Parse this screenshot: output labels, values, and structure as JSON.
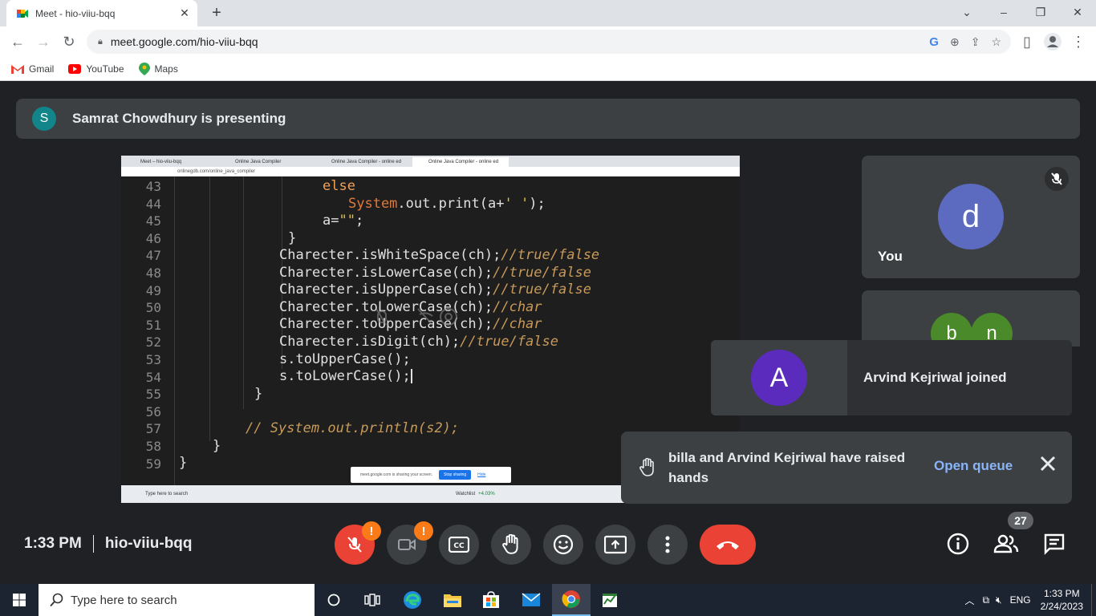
{
  "browser": {
    "tab_title": "Meet - hio-viiu-bqq",
    "url": "meet.google.com/hio-viiu-bqq",
    "bookmarks": [
      "Gmail",
      "YouTube",
      "Maps"
    ]
  },
  "presenting": {
    "avatar_letter": "S",
    "text": "Samrat Chowdhury is presenting"
  },
  "shared_screen": {
    "tabs": [
      "Meet – hio-viiu-bqq",
      "Online Java Compiler",
      "Online Java Compiler - online ed",
      "Online Java Compiler - online ed"
    ],
    "url": "onlinegdb.com/online_java_compiler",
    "line_numbers": [
      "43",
      "44",
      "45",
      "46",
      "47",
      "48",
      "49",
      "50",
      "51",
      "52",
      "53",
      "54",
      "55",
      "56",
      "57",
      "58",
      "59"
    ],
    "code": {
      "l43": "else",
      "l44a": "System",
      "l44b": ".out.print(a+",
      "l44c": "' '",
      "l44d": ");",
      "l45a": "a=",
      "l45b": "\"\"",
      "l45c": ";",
      "l46": "}",
      "l47a": "Charecter.isWhiteSpace(ch);",
      "l47b": "//true/false",
      "l48a": "Charecter.isLowerCase(ch);",
      "l48b": "//true/false",
      "l49a": "Charecter.isUpperCase(ch);",
      "l49b": "//true/false",
      "l50a": "Charecter.toLowerCase(ch);",
      "l50b": "//char",
      "l51a": "Charecter.toUpperCase(ch);",
      "l51b": "//char",
      "l52a": "Charecter.isDigit(ch);",
      "l52b": "//true/false",
      "l53": "s.toUpperCase();",
      "l54": "s.toLowerCase();",
      "l55": "}",
      "l57": "// System.out.println(s2);",
      "l58": "}",
      "l59": "}"
    },
    "share_notice": "meet.google.com is sharing your screen.",
    "stop_sharing": "Stop sharing",
    "hide": "Hide",
    "taskbar_search": "Type here to search",
    "watchlist": "Watchlist",
    "watchlist_change": "+4.03%"
  },
  "self_tile": {
    "avatar_letter": "d",
    "name": "You",
    "avatar_color": "#5c6bc0"
  },
  "other_tile": {
    "letters": [
      "b",
      "n"
    ]
  },
  "joined_toast": {
    "avatar_letter": "A",
    "text": "Arvind Kejriwal joined",
    "avatar_color": "#5b2bbd"
  },
  "hands_toast": {
    "message": "billa and Arvind Kejriwal have raised hands",
    "action": "Open queue"
  },
  "meeting": {
    "time": "1:33 PM",
    "code": "hio-viiu-bqq",
    "participant_count": "27",
    "mic_badge": "!",
    "cam_badge": "!"
  },
  "taskbar": {
    "search_placeholder": "Type here to search",
    "lang": "ENG",
    "time": "1:33 PM",
    "date": "2/24/2023"
  },
  "colors": {
    "meet_bg": "#202124",
    "tile_bg": "#3c4043",
    "end_call": "#ea4335",
    "link": "#8ab4f8"
  }
}
